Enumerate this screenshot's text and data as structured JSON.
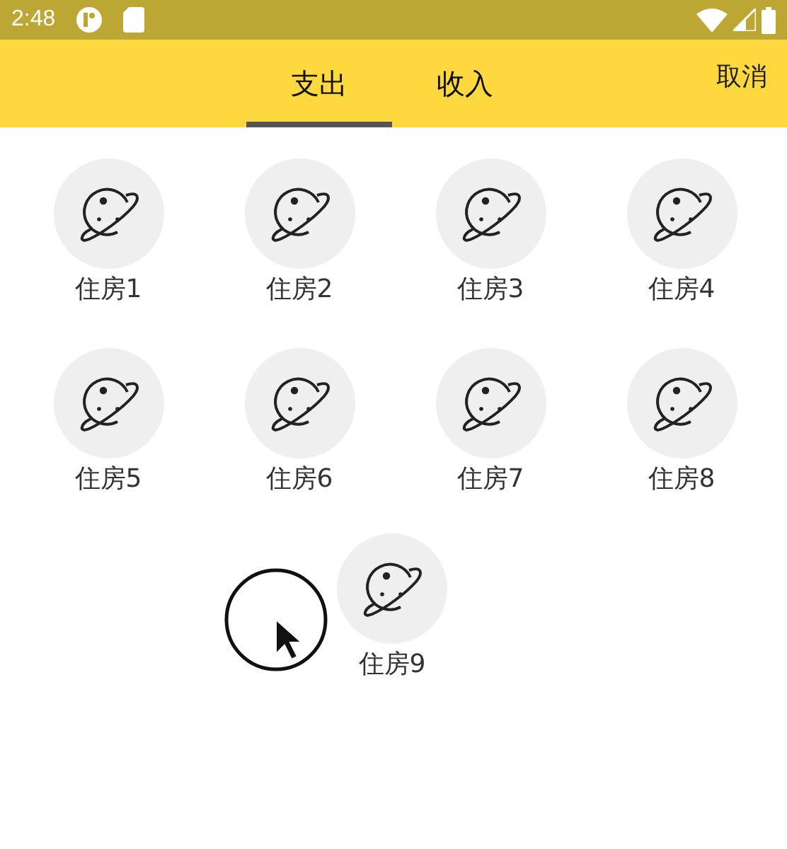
{
  "status_bar": {
    "time": "2:48"
  },
  "tabs": [
    {
      "label": "支出",
      "selected": true
    },
    {
      "label": "收入",
      "selected": false
    }
  ],
  "cancel": "取消",
  "categories": [
    {
      "label": "住房1",
      "dragging": false
    },
    {
      "label": "住房2",
      "dragging": false
    },
    {
      "label": "住房3",
      "dragging": false
    },
    {
      "label": "住房4",
      "dragging": false
    },
    {
      "label": "住房5",
      "dragging": false
    },
    {
      "label": "住房6",
      "dragging": false
    },
    {
      "label": "住房7",
      "dragging": false
    },
    {
      "label": "住房8",
      "dragging": false
    },
    {
      "label": "住房9",
      "dragging": true
    }
  ]
}
